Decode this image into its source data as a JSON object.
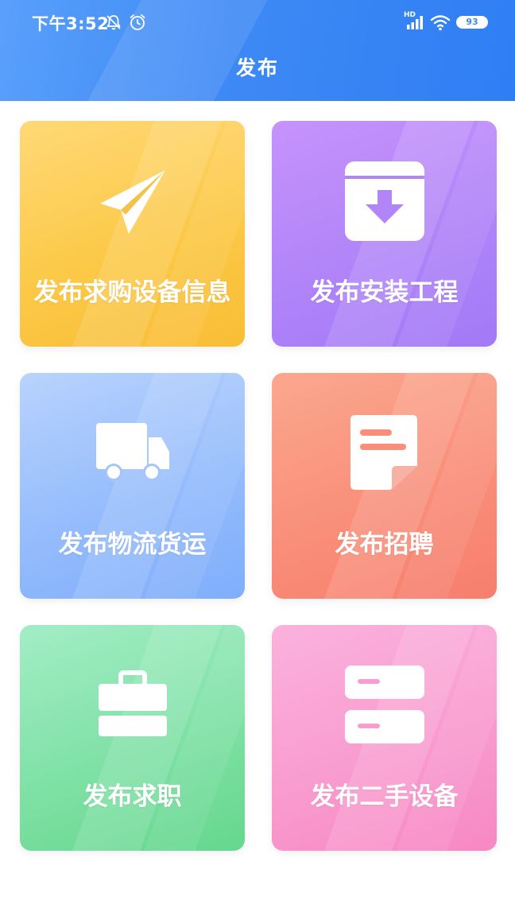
{
  "status_bar": {
    "time": "下午3:52",
    "network": "HD",
    "battery_level": "93",
    "icons": [
      "mute-bell-icon",
      "alarm-icon",
      "signal-icon",
      "wifi-icon",
      "battery-icon"
    ]
  },
  "header": {
    "title": "发布",
    "background_color": "#3d89f5"
  },
  "cards": [
    {
      "label": "发布求购设备信息",
      "icon": "paper-plane-icon",
      "color": "#fcc947"
    },
    {
      "label": "发布安装工程",
      "icon": "box-download-icon",
      "color": "#b184f8"
    },
    {
      "label": "发布物流货运",
      "icon": "truck-icon",
      "color": "#95bcfc"
    },
    {
      "label": "发布招聘",
      "icon": "document-icon",
      "color": "#f98f7a"
    },
    {
      "label": "发布求职",
      "icon": "briefcase-icon",
      "color": "#7fe1a5"
    },
    {
      "label": "发布二手设备",
      "icon": "storage-drawer-icon",
      "color": "#f99ccf"
    }
  ]
}
